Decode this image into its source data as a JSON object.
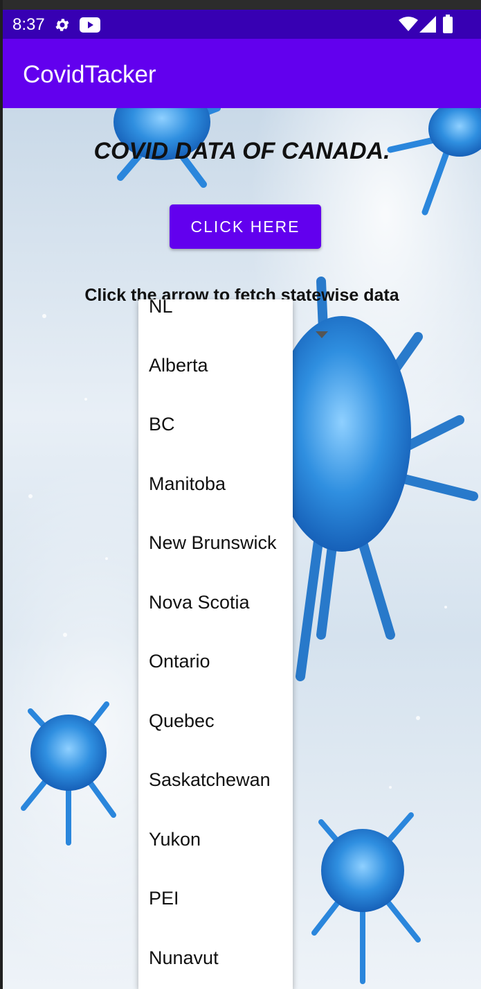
{
  "status_bar": {
    "time": "8:37",
    "icons": [
      "gear-icon",
      "youtube-icon",
      "wifi-icon",
      "signal-icon",
      "battery-icon"
    ]
  },
  "app_bar": {
    "title": "CovidTacker"
  },
  "main": {
    "headline": "COVID DATA OF CANADA.",
    "button_label": "CLICK HERE",
    "hint": "Click the arrow to fetch statewise data"
  },
  "dropdown": {
    "items": [
      "NL",
      "Alberta",
      "BC",
      "Manitoba",
      "New Brunswick",
      "Nova Scotia",
      "Ontario",
      "Quebec",
      "Saskatchewan",
      "Yukon",
      "PEI",
      "Nunavut"
    ]
  },
  "colors": {
    "status_bar": "#3700b3",
    "app_bar": "#6200ee",
    "button": "#6200ee"
  }
}
